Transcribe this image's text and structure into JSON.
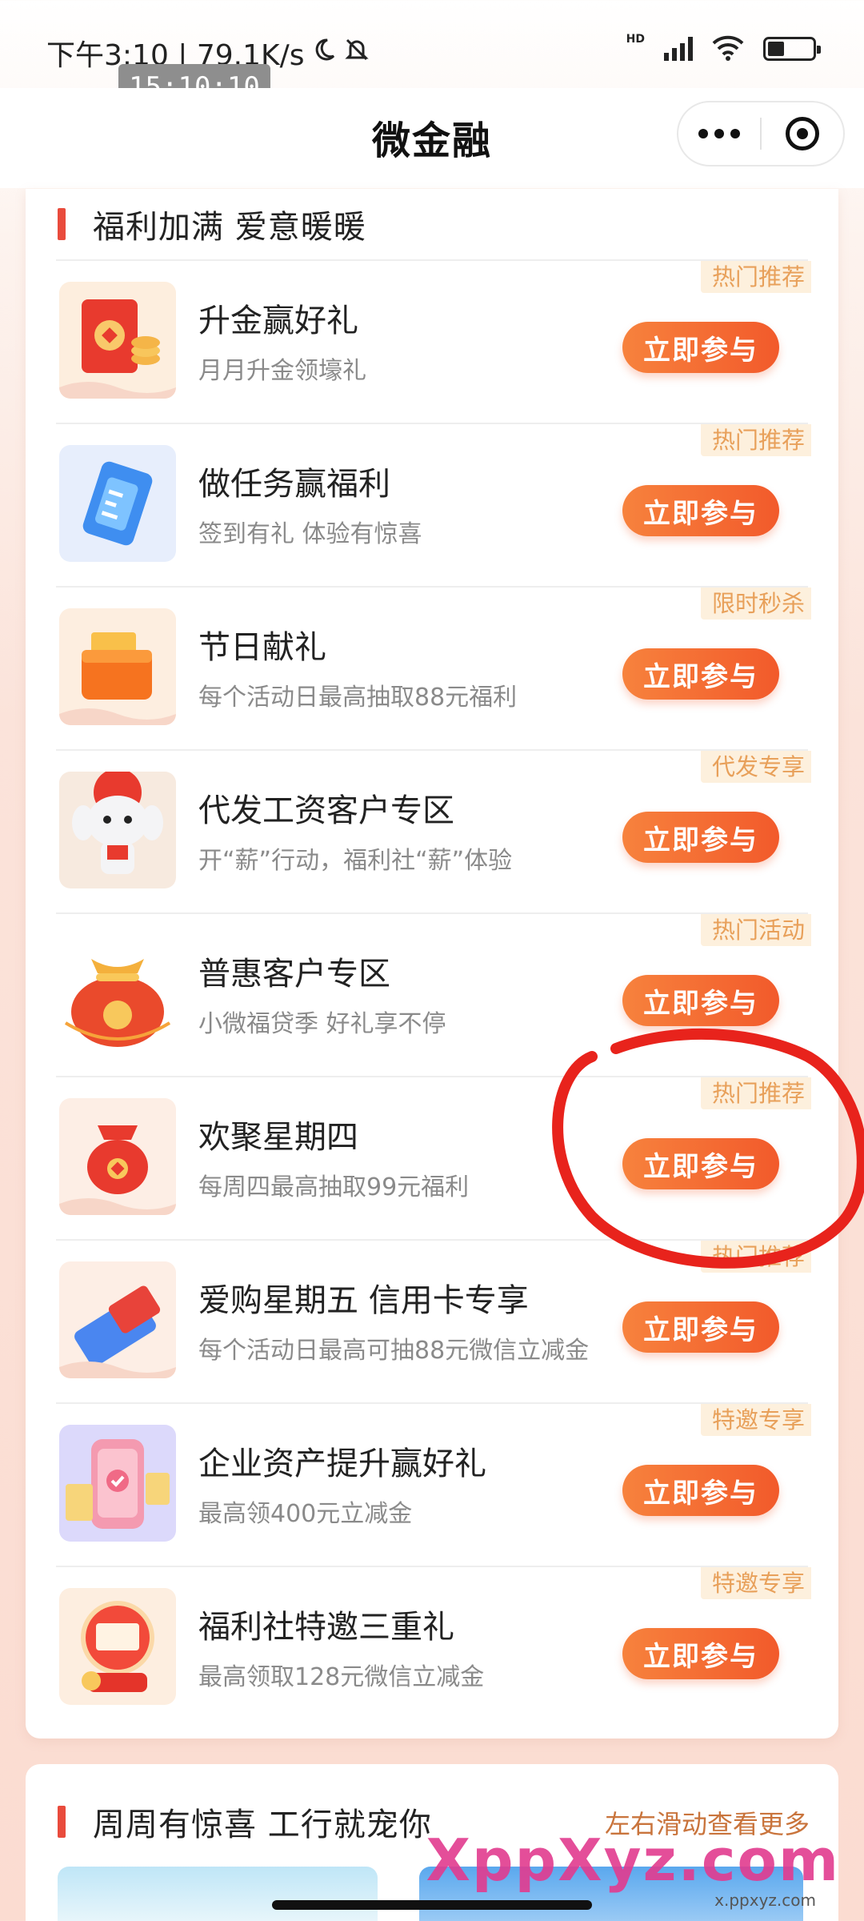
{
  "status_bar": {
    "left_text": "下午3:10 | 79.1K/s",
    "time_chip": "15:10:10",
    "network": "HD"
  },
  "header": {
    "title": "微金融"
  },
  "section1": {
    "title": "福利加满 爱意暖暖",
    "button_label": "立即参与",
    "items": [
      {
        "tag": "热门推荐",
        "title": "升金赢好礼",
        "subtitle": "月月升金领壕礼",
        "icon": "red-envelope-icon"
      },
      {
        "tag": "热门推荐",
        "title": "做任务赢福利",
        "subtitle": "签到有礼 体验有惊喜",
        "icon": "task-clipboard-icon"
      },
      {
        "tag": "限时秒杀",
        "title": "节日献礼",
        "subtitle": "每个活动日最高抽取88元福利",
        "icon": "gift-box-icon"
      },
      {
        "tag": "代发专享",
        "title": "代发工资客户专区",
        "subtitle": "开“薪”行动，福利社“薪”体验",
        "icon": "mascot-icon"
      },
      {
        "tag": "热门活动",
        "title": "普惠客户专区",
        "subtitle": "小微福贷季 好礼享不停",
        "icon": "lucky-bag-icon"
      },
      {
        "tag": "热门推荐",
        "title": "欢聚星期四",
        "subtitle": "每周四最高抽取99元福利",
        "icon": "money-bag-icon"
      },
      {
        "tag": "热门推荐",
        "title": "爱购星期五 信用卡专享",
        "subtitle": "每个活动日最高可抽88元微信立减金",
        "icon": "credit-card-icon"
      },
      {
        "tag": "特邀专享",
        "title": "企业资产提升赢好礼",
        "subtitle": "最高领400元立减金",
        "icon": "phone-coupon-icon"
      },
      {
        "tag": "特邀专享",
        "title": "福利社特邀三重礼",
        "subtitle": "最高领取128元微信立减金",
        "icon": "gift-globe-icon"
      }
    ]
  },
  "section2": {
    "title": "周周有惊喜 工行就宠你",
    "more_link": "左右滑动查看更多"
  },
  "watermark": {
    "text": "XppXyz.com",
    "sub": "x.ppxyz.com"
  },
  "colors": {
    "accent": "#f25a2b",
    "tag_text": "#e8a05a",
    "tag_bg": "#fdf0dd",
    "section_bar": "#e94b3c",
    "annotation": "#e8231c"
  }
}
